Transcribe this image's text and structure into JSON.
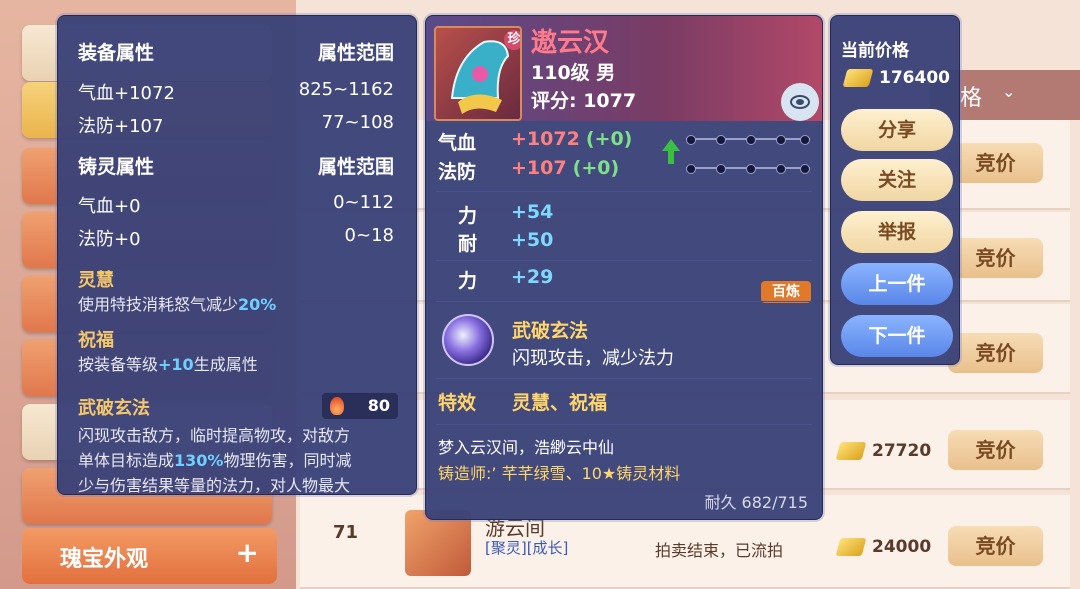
{
  "background": {
    "header_label": "格",
    "bid_label": "竞价",
    "rows": [
      {
        "price": "27720"
      },
      {
        "price": "24000"
      }
    ],
    "last_item": {
      "count": "71",
      "name": "游云间",
      "tags": "[聚灵][成长]",
      "status": "拍卖结束，已流拍"
    },
    "jewel_tab": {
      "label": "瑰宝外观",
      "icon": "plus-icon"
    }
  },
  "left_panel": {
    "equip_header": "装备属性",
    "equip_range_header": "属性范围",
    "equip_attrs": [
      {
        "name": "气血+1072",
        "range": "825~1162"
      },
      {
        "name": "法防+107",
        "range": "77~108"
      }
    ],
    "forge_header": "铸灵属性",
    "forge_range_header": "属性范围",
    "forge_attrs": [
      {
        "name": "气血+0",
        "range": "0~112"
      },
      {
        "name": "法防+0",
        "range": "0~18"
      }
    ],
    "effects": [
      {
        "title": "灵慧",
        "pre": "使用特技消耗怒气减少",
        "hl": "20%",
        "post": ""
      },
      {
        "title": "祝福",
        "pre": "按装备等级",
        "hl": "+10",
        "post": "生成属性"
      }
    ],
    "skill": {
      "title": "武破玄法",
      "fire_value": "80",
      "line1": "闪现攻击敌方，临时提高物攻，对敌方",
      "line2_pre": "单体目标造成",
      "line2_hl": "130%",
      "line2_post": "物理伤害，同时减",
      "line3": "少与伤害结果等量的法力，对人物最大"
    }
  },
  "center_panel": {
    "badge": "珍",
    "name": "遨云汉",
    "level_gender": "110级 男",
    "score": "评分: 1077",
    "stats": [
      {
        "label": "气血",
        "value": "+1072",
        "delta": "(+0)"
      },
      {
        "label": "法防",
        "value": "+107",
        "delta": "(+0)"
      }
    ],
    "sub_stats": [
      {
        "label": "力",
        "value": "+54"
      },
      {
        "label": "耐",
        "value": "+50"
      }
    ],
    "bailian_stat": {
      "label": "力",
      "value": "+29",
      "badge": "百炼"
    },
    "skill_name": "武破玄法",
    "skill_desc": "闪现攻击，减少法力",
    "effect_label": "特效",
    "effect_value": "灵慧、祝福",
    "flavor": "梦入云汉间，浩緲云中仙",
    "forger": "铸造师:’ 芊芊绿雪、10★铸灵材料",
    "durability": "耐久 682/715"
  },
  "right_panel": {
    "price_label": "当前价格",
    "price": "176400",
    "buttons": {
      "share": "分享",
      "follow": "关注",
      "report": "举报",
      "prev": "上一件",
      "next": "下一件"
    }
  },
  "colors": {
    "panel_bg": "#3a4278",
    "accent_red": "#ff8080",
    "accent_green": "#7fe08a",
    "accent_cyan": "#7fd8ff",
    "gold_text": "#f4c86a"
  }
}
